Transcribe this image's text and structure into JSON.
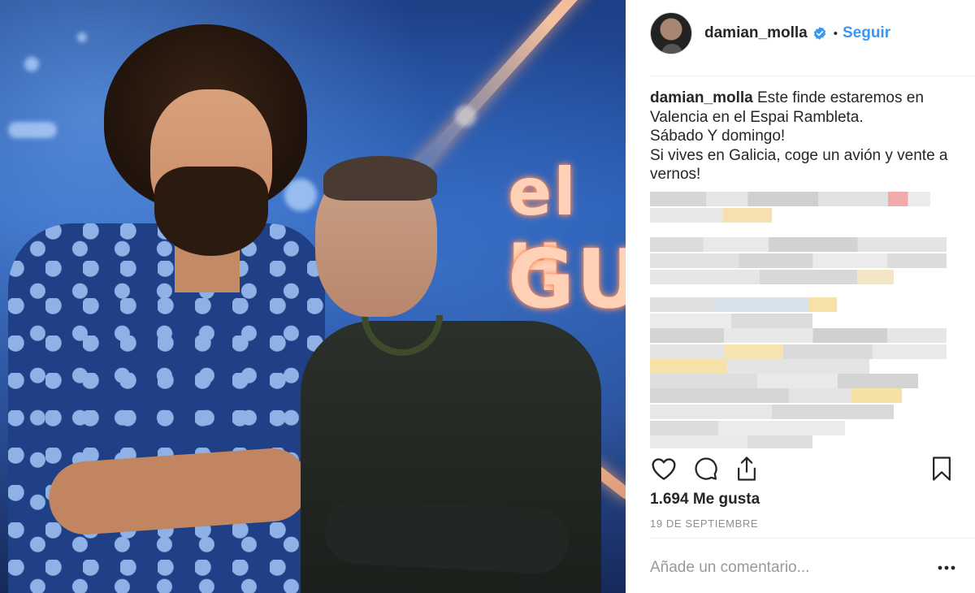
{
  "post": {
    "username": "damian_molla",
    "verified": true,
    "separator": "•",
    "follow_label": "Seguir",
    "caption": {
      "user": "damian_molla",
      "lines": [
        "Este finde estaremos en",
        "Valencia en el Espai Rambleta.",
        "Sábado Y domingo!",
        "Si vives en Galicia, coge un avión y vente a",
        "vernos!"
      ]
    },
    "likes_text": "1.694 Me gusta",
    "date_text": "19 DE SEPTIEMBRE",
    "comment_placeholder": "Añade un comentario...",
    "photo_sign_text": [
      "el H",
      "GU"
    ]
  },
  "icons": {
    "like": "heart-icon",
    "comment": "comment-bubble-icon",
    "share": "share-icon",
    "save": "bookmark-icon",
    "more": "more-options-icon",
    "verified": "verified-badge-icon"
  },
  "colors": {
    "link_blue": "#3897f0",
    "verified_blue": "#3897f0",
    "text": "#262626",
    "secondary_text": "#8e8e8e"
  }
}
